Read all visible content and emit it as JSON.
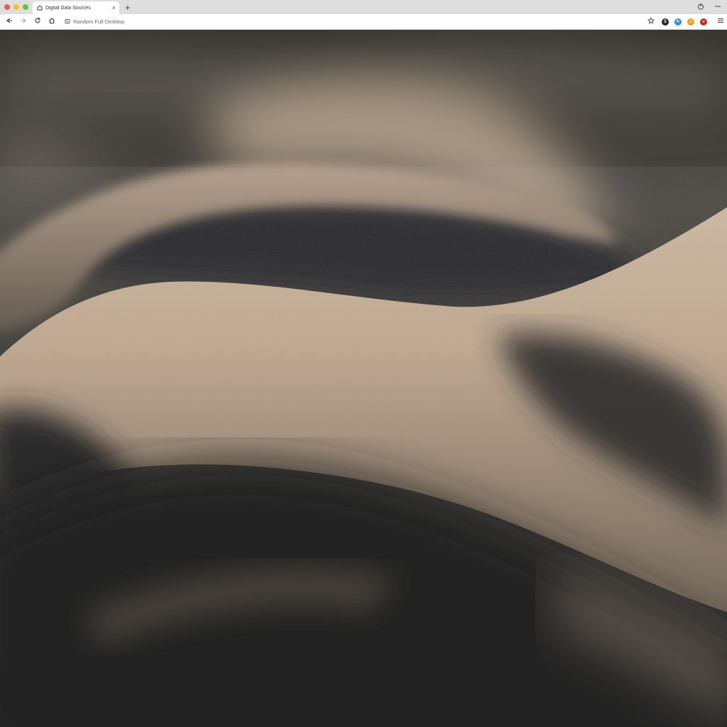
{
  "window": {
    "traffic_lights": [
      "close",
      "minimize",
      "maximize"
    ]
  },
  "tab": {
    "title": "Digital Data Sources",
    "close_glyph": "×"
  },
  "tabstrip": {
    "new_tab_glyph": "+",
    "right_icons": [
      "power-icon",
      "minimize-icon"
    ]
  },
  "toolbar": {
    "url": "Random Full Desktop",
    "star_icon": "star-icon",
    "extensions": [
      "ext-dark-icon",
      "ext-blue-icon",
      "ext-orange-icon",
      "ext-red-icon"
    ],
    "menu_icon": "hamburger-menu-icon"
  },
  "colors": {
    "tabstrip_bg": "#dedede",
    "toolbar_bg": "#ffffff",
    "sand_light": "#cdb8a0",
    "sand_mid": "#a08a74",
    "sand_shadow": "#3a3936",
    "sand_deep": "#1f1e1d"
  },
  "content": {
    "image_subject": "close-up photograph of rippled sand"
  }
}
